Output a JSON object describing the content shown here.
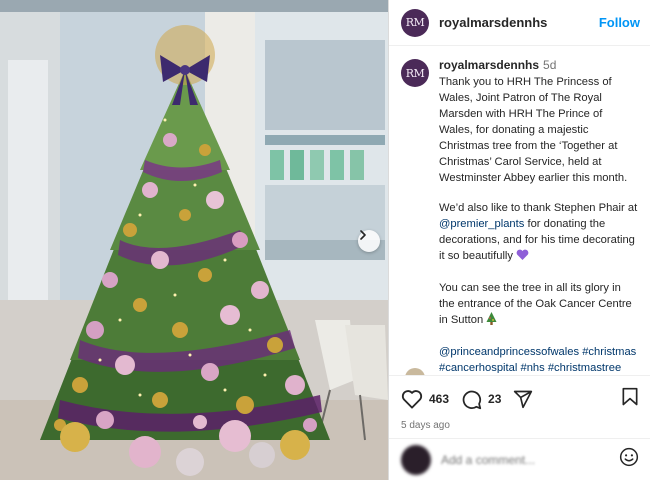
{
  "post": {
    "username": "royalmarsdennhs",
    "avatar_initials": "RM",
    "follow_label": "Follow",
    "more_label": "•••",
    "time_ago": "5d",
    "caption_paragraphs": [
      {
        "parts": [
          {
            "text": "Thank you to HRH The Princess of Wales, Joint Patron of The Royal Marsden with HRH The Prince of Wales, for donating a majestic Christmas tree from the ‘Together at Christmas’ Carol Service, held at Westminster Abbey earlier this month."
          }
        ]
      },
      {
        "parts": [
          {
            "text": "We’d also like to thank Stephen Phair at "
          },
          {
            "text": "@premier_plants",
            "tag": true
          },
          {
            "text": " for donating the decorations, and for his time decorating it so beautifully "
          }
        ],
        "emoji": "purple-heart"
      },
      {
        "parts": [
          {
            "text": "You can see the tree in all its glory in the entrance of the Oak Cancer Centre in Sutton "
          }
        ],
        "emoji": "christmas-tree"
      },
      {
        "parts": [
          {
            "text": "@princeandprincessofwales #christmas #cancerhospital #nhs #christmastree",
            "tag": true
          }
        ]
      }
    ],
    "likes": "463",
    "comments": "23",
    "timestamp": "5 days ago",
    "comment_placeholder": "Add a comment...",
    "colors": {
      "accent": "#0095f6",
      "tag": "#00376b",
      "avatar": "#4b2a58"
    }
  },
  "image": {
    "subject": "decorated Christmas tree with purple, pink and gold ornaments in a building lobby"
  }
}
